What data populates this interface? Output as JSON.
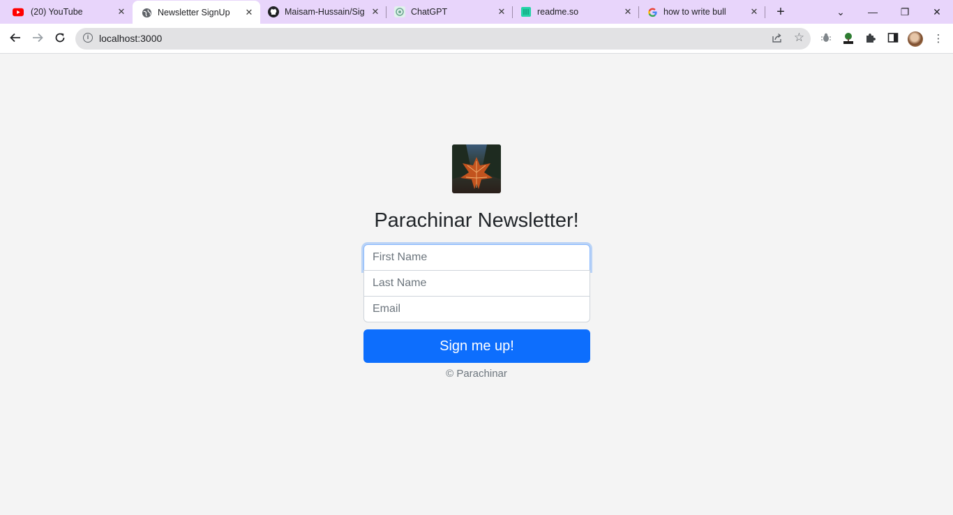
{
  "browser": {
    "tabs": [
      {
        "title": "(20) YouTube",
        "icon": "youtube-icon"
      },
      {
        "title": "Newsletter SignUp",
        "icon": "globe-icon"
      },
      {
        "title": "Maisam-Hussain/Sign",
        "icon": "github-icon"
      },
      {
        "title": "ChatGPT",
        "icon": "chatgpt-icon"
      },
      {
        "title": "readme.so",
        "icon": "readme-icon"
      },
      {
        "title": "how to write bullets fo",
        "icon": "google-icon"
      }
    ],
    "active_tab_index": 1,
    "url": "localhost:3000",
    "colors": {
      "tabstrip": "#e8d5fb",
      "omnibox": "#e2e2e4"
    }
  },
  "page": {
    "heading": "Parachinar Newsletter!",
    "form": {
      "first_name_placeholder": "First Name",
      "last_name_placeholder": "Last Name",
      "email_placeholder": "Email",
      "submit_label": "Sign me up!"
    },
    "footer": "© Parachinar",
    "colors": {
      "background": "#f4f4f4",
      "primary": "#0d6efd",
      "heading": "#212529"
    }
  }
}
